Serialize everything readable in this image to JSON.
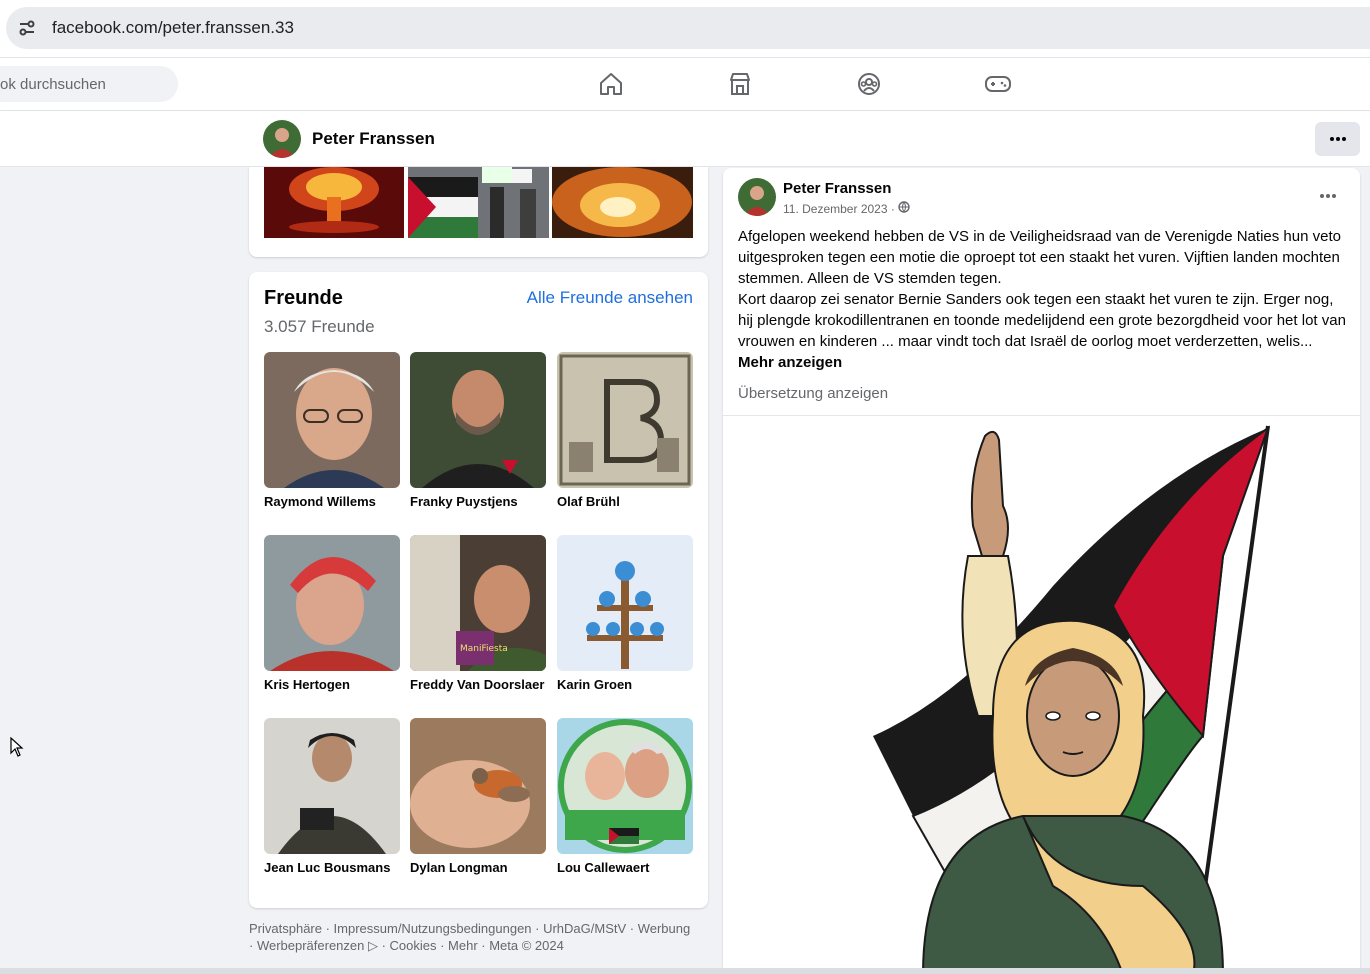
{
  "browser": {
    "url": "facebook.com/peter.franssen.33"
  },
  "nav": {
    "search_placeholder": "ok durchsuchen",
    "icons": [
      "home-icon",
      "marketplace-icon",
      "groups-icon",
      "gaming-icon"
    ]
  },
  "profile": {
    "name": "Peter Franssen"
  },
  "friends": {
    "title": "Freunde",
    "count": "3.057 Freunde",
    "see_all": "Alle Freunde ansehen",
    "list": [
      {
        "name": "Raymond Willems",
        "color": "#8a6e5c"
      },
      {
        "name": "Franky Puystjens",
        "color": "#3e4b35"
      },
      {
        "name": "Olaf Brühl",
        "color": "#bdb6a3"
      },
      {
        "name": "Kris Hertogen",
        "color": "#c04a3a"
      },
      {
        "name": "Freddy Van Doorslaer",
        "color": "#5a4a3e"
      },
      {
        "name": "Karin Groen",
        "color": "#dfe9f3"
      },
      {
        "name": "Jean Luc Bousmans",
        "color": "#3d3a35"
      },
      {
        "name": "Dylan Longman",
        "color": "#c99a78"
      },
      {
        "name": "Lou Callewaert",
        "color": "#7fc58a"
      }
    ]
  },
  "footer": {
    "line1": "Privatsphäre · Impressum/Nutzungsbedingungen · UrhDaG/MStV · Werbung",
    "line2": "· Werbepräferenzen ▷ · Cookies · Mehr · Meta © 2024"
  },
  "post": {
    "author": "Peter Franssen",
    "date": "11. Dezember 2023 ·",
    "paragraph1": "Afgelopen weekend hebben de VS in de Veiligheidsraad van de Verenigde Naties hun veto uitgesproken tegen een motie die oproept tot een staakt het vuren. Vijftien landen mochten stemmen. Alleen de VS stemden tegen.",
    "paragraph2": "Kort daarop zei senator Bernie Sanders ook tegen een staakt het vuren te zijn. Erger nog, hij plengde krokodillentranen en toonde medelijdend een grote bezorgdheid voor het lot van vrouwen en kinderen ... maar vindt toch dat Israël de oorlog moet verderzetten, welis...",
    "see_more": "Mehr anzeigen",
    "translate": "Übersetzung anzeigen"
  },
  "colors": {
    "link": "#216fdb",
    "flag_red": "#c8102e",
    "flag_green": "#2f7a3b",
    "flag_black": "#1a1a1a"
  }
}
